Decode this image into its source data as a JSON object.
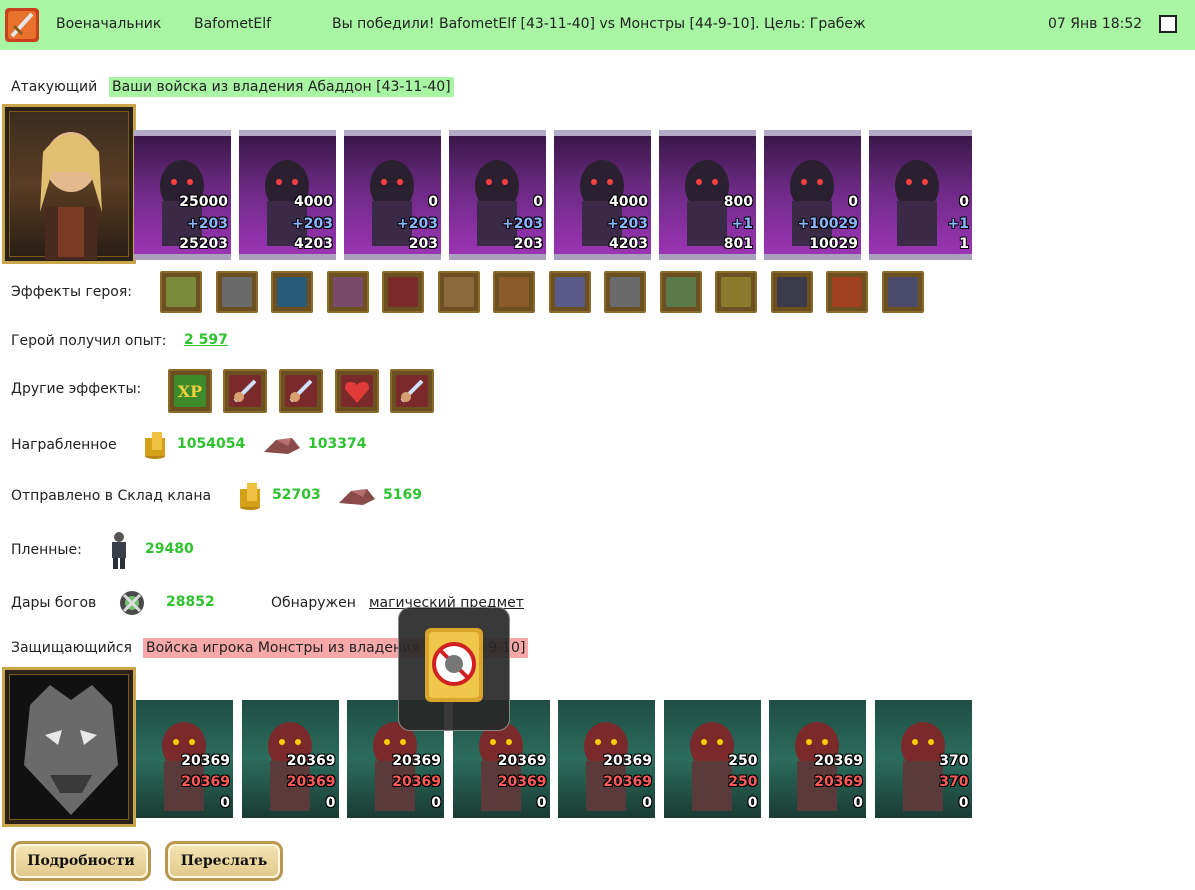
{
  "header": {
    "role": "Военачальник",
    "player": "BafometElf",
    "result": "Вы победили! BafometElf [43-11-40] vs Монстры [44-9-10]. Цель: Грабеж",
    "datetime": "07 Янв 18:52"
  },
  "attacker": {
    "label": "Атакующий",
    "source": "Ваши войска из владения Абаддон [43-11-40]",
    "units": [
      {
        "a": "25000",
        "b": "+203",
        "c": "25203"
      },
      {
        "a": "4000",
        "b": "+203",
        "c": "4203"
      },
      {
        "a": "0",
        "b": "+203",
        "c": "203"
      },
      {
        "a": "0",
        "b": "+203",
        "c": "203"
      },
      {
        "a": "4000",
        "b": "+203",
        "c": "4203"
      },
      {
        "a": "800",
        "b": "+1",
        "c": "801"
      },
      {
        "a": "0",
        "b": "+10029",
        "c": "10029"
      },
      {
        "a": "0",
        "b": "+1",
        "c": "1"
      }
    ]
  },
  "hero_effects": {
    "label": "Эффекты героя:",
    "icons": [
      "gold-bag-icon",
      "castle-icon",
      "potion-icon",
      "crown-icon",
      "armor-icon",
      "helmet-icon",
      "belt-icon",
      "ring-icon",
      "chain-icon",
      "sword-icon",
      "shield-icon",
      "boots-icon",
      "cloak-icon",
      "gauntlet-icon"
    ]
  },
  "experience": {
    "label": "Герой получил опыт:",
    "value": "2 597"
  },
  "other_effects": {
    "label": "Другие эффекты:",
    "xp_text": "XP",
    "icons": [
      "xp-icon",
      "fist-sword-icon",
      "fist-sword-icon",
      "heart-sword-icon",
      "fist-sword-icon"
    ]
  },
  "loot": {
    "label": "Награбленное",
    "gold": "1054054",
    "ore": "103374"
  },
  "clan_storage": {
    "label": "Отправлено в Склад клана",
    "gold": "52703",
    "ore": "5169"
  },
  "prisoners": {
    "label": "Пленные:",
    "value": "29480"
  },
  "gifts": {
    "label": "Дары богов",
    "value": "28852",
    "found_label": "Обнаружен",
    "found_item": "магический предмет"
  },
  "defender": {
    "label": "Защищающийся",
    "source": "Войска игрока Монстры из владения Ямы [44-9-10]",
    "units": [
      {
        "a": "20369",
        "b": "20369",
        "c": "0"
      },
      {
        "a": "20369",
        "b": "20369",
        "c": "0"
      },
      {
        "a": "20369",
        "b": "20369",
        "c": "0"
      },
      {
        "a": "20369",
        "b": "20369",
        "c": "0"
      },
      {
        "a": "20369",
        "b": "20369",
        "c": "0"
      },
      {
        "a": "250",
        "b": "250",
        "c": "0"
      },
      {
        "a": "20369",
        "b": "20369",
        "c": "0"
      },
      {
        "a": "370",
        "b": "370",
        "c": "0"
      }
    ]
  },
  "buttons": {
    "details": "Подробности",
    "forward": "Переслать"
  },
  "colors": {
    "topbar": "#a8f5a3",
    "green_value": "#2fc22f",
    "defender_hl": "#f7a8a8"
  }
}
